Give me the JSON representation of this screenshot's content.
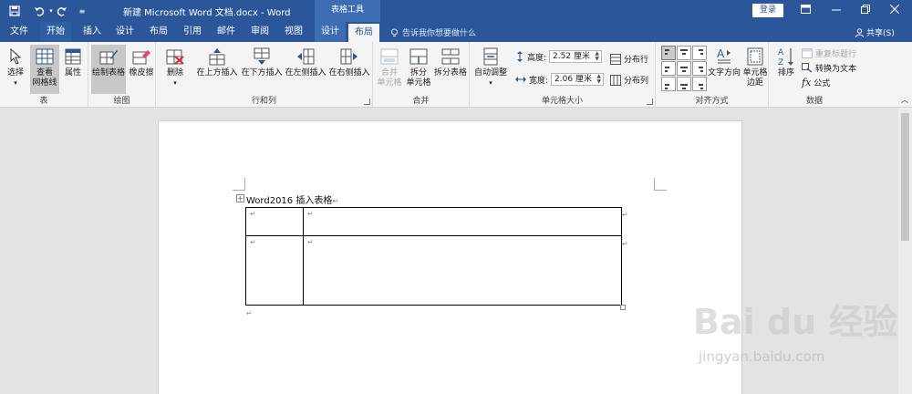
{
  "titlebar": {
    "title": "新建 Microsoft Word 文档.docx - Word",
    "context_group": "表格工具",
    "login": "登录",
    "save_icon": "save-icon",
    "undo_icon": "undo-icon",
    "redo_icon": "redo-icon"
  },
  "tabs": [
    {
      "label": "文件"
    },
    {
      "label": "开始"
    },
    {
      "label": "插入"
    },
    {
      "label": "设计"
    },
    {
      "label": "布局"
    },
    {
      "label": "引用"
    },
    {
      "label": "邮件"
    },
    {
      "label": "审阅"
    },
    {
      "label": "视图"
    },
    {
      "label": "设计"
    },
    {
      "label": "布局"
    }
  ],
  "tell_me": "告诉我你想要做什么",
  "share": "共享(S)",
  "ribbon": {
    "table_group": {
      "label": "表",
      "select": "选择",
      "view_gridlines_1": "查看",
      "view_gridlines_2": "网格线",
      "properties": "属性"
    },
    "draw_group": {
      "label": "绘图",
      "draw_table": "绘制表格",
      "eraser": "橡皮擦"
    },
    "rows_cols_group": {
      "label": "行和列",
      "delete": "删除",
      "insert_above": "在上方插入",
      "insert_below": "在下方插入",
      "insert_left": "在左侧插入",
      "insert_right": "在右侧插入"
    },
    "merge_group": {
      "label": "合并",
      "merge_cells_1": "合并",
      "merge_cells_2": "单元格",
      "split_cells_1": "拆分",
      "split_cells_2": "单元格",
      "split_table": "拆分表格"
    },
    "cell_size_group": {
      "label": "单元格大小",
      "autofit": "自动调整",
      "height_label": "高度:",
      "height_value": "2.52 厘米",
      "width_label": "宽度:",
      "width_value": "2.06 厘米",
      "distribute_rows": "分布行",
      "distribute_cols": "分布列"
    },
    "alignment_group": {
      "label": "对齐方式",
      "text_direction": "文字方向",
      "cell_margins_1": "单元格",
      "cell_margins_2": "边距"
    },
    "data_group": {
      "label": "数据",
      "sort": "排序",
      "repeat_header": "重复标题行",
      "convert_to_text": "转换为文本",
      "formula": "公式"
    }
  },
  "document": {
    "heading": "Word2016 插入表格",
    "para_mark": "↵"
  },
  "watermark": {
    "brand": "Bai du 经验",
    "url": "jingyan.baidu.com"
  },
  "colors": {
    "titlebar": "#2b579a",
    "ribbon_bg": "#f4f4f4",
    "page_bg": "#ffffff"
  }
}
